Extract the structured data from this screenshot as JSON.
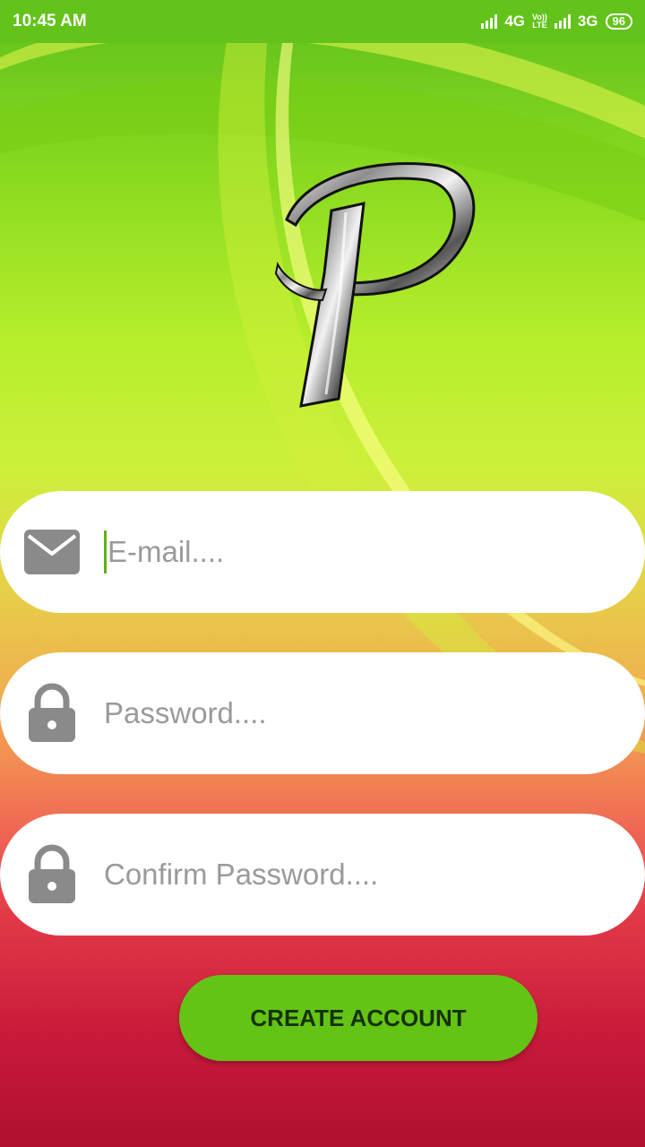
{
  "status_bar": {
    "time": "10:45 AM",
    "network_1": "4G",
    "volte_top": "Vo))",
    "volte_bottom": "LTE",
    "network_2": "3G",
    "battery": "96"
  },
  "logo": {
    "icon": "letter-p-logo"
  },
  "form": {
    "email": {
      "placeholder": "E-mail....",
      "icon": "envelope-icon"
    },
    "password": {
      "placeholder": "Password....",
      "icon": "lock-icon"
    },
    "confirm_password": {
      "placeholder": "Confirm Password....",
      "icon": "lock-icon"
    },
    "submit_label": "CREATE ACCOUNT"
  },
  "colors": {
    "accent": "#64c416",
    "status_bar": "#63c31a",
    "icon": "#8a8a8a",
    "placeholder": "#9a9a9a"
  }
}
